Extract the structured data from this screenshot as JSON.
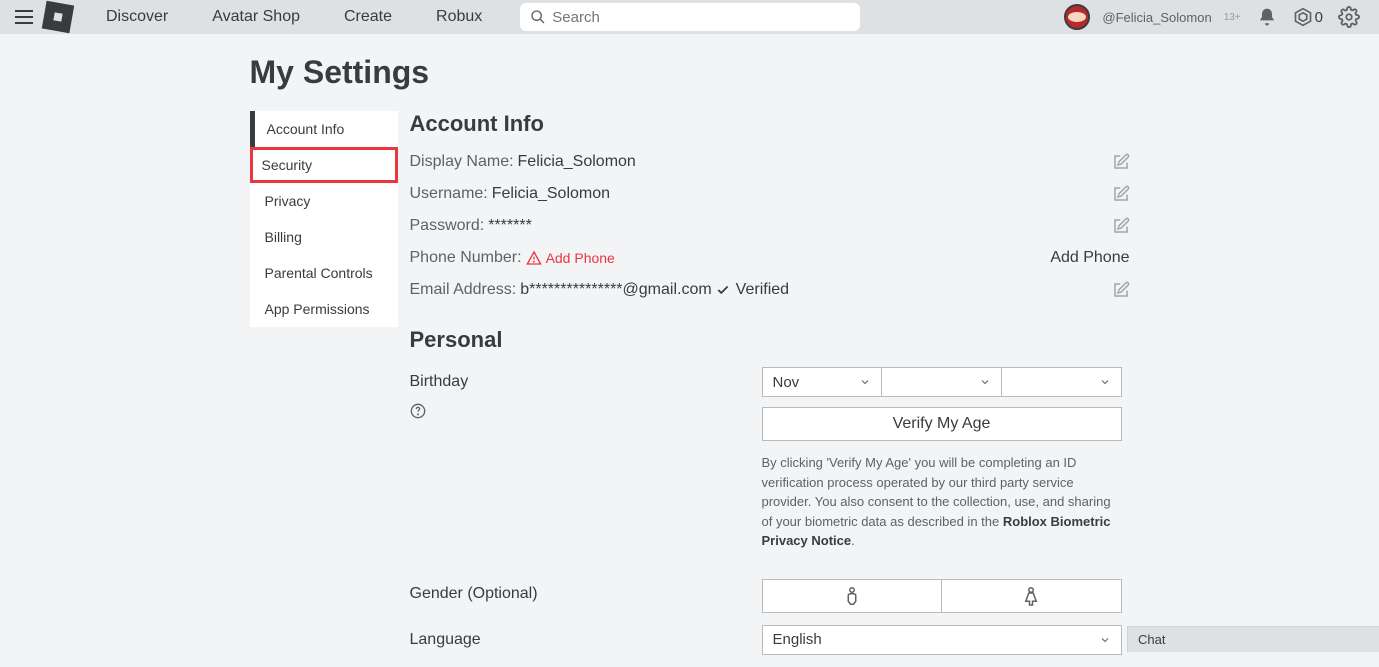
{
  "topnav": {
    "links": [
      "Discover",
      "Avatar Shop",
      "Create",
      "Robux"
    ],
    "search_placeholder": "Search",
    "username": "@Felicia_Solomon",
    "age_badge": "13+",
    "robux": "0"
  },
  "page_title": "My Settings",
  "sidebar": {
    "items": [
      "Account Info",
      "Security",
      "Privacy",
      "Billing",
      "Parental Controls",
      "App Permissions"
    ]
  },
  "account_info": {
    "heading": "Account Info",
    "display_name_label": "Display Name:",
    "display_name": "Felicia_Solomon",
    "username_label": "Username:",
    "username": "Felicia_Solomon",
    "password_label": "Password:",
    "password": "*******",
    "phone_label": "Phone Number:",
    "add_phone_inline": "Add Phone",
    "add_phone_action": "Add Phone",
    "email_label": "Email Address:",
    "email": "b***************@gmail.com",
    "email_status": "Verified"
  },
  "personal": {
    "heading": "Personal",
    "birthday_label": "Birthday",
    "month": "Nov",
    "day": "",
    "year": "",
    "verify_btn": "Verify My Age",
    "disclaimer_a": "By clicking 'Verify My Age' you will be completing an ID verification process operated by our third party service provider. You also consent to the collection, use, and sharing of your biometric data as described in the ",
    "disclaimer_link": "Roblox Biometric Privacy Notice",
    "disclaimer_b": ".",
    "gender_label": "Gender (Optional)",
    "language_label": "Language",
    "language": "English"
  },
  "chat_label": "Chat"
}
